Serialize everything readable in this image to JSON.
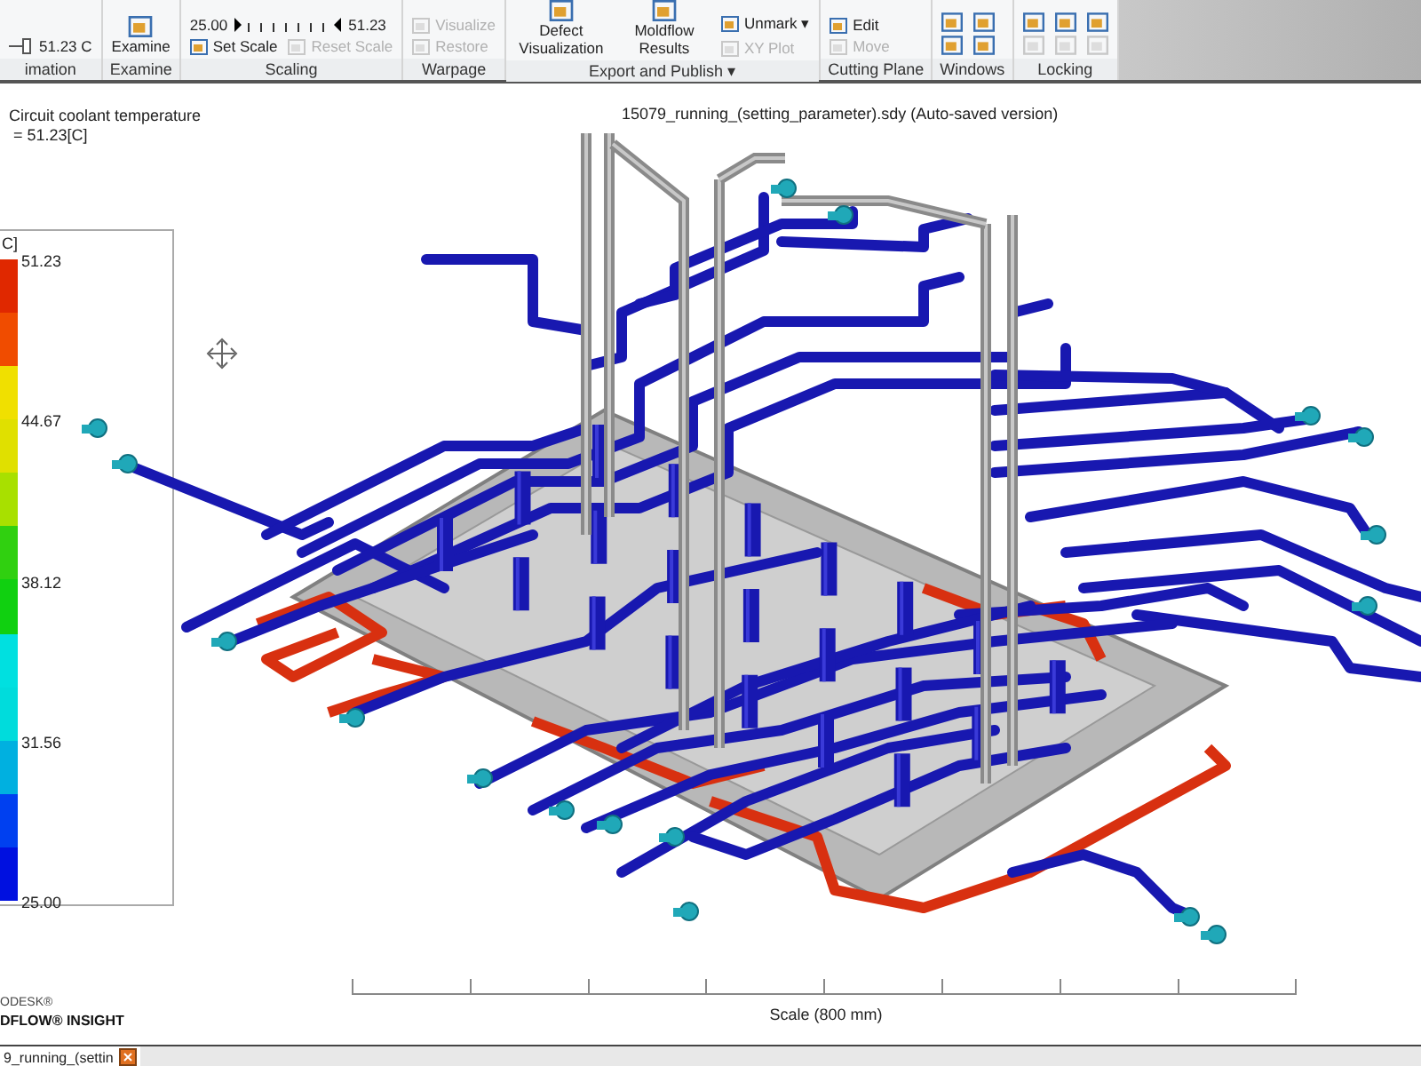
{
  "ribbon": {
    "groups": [
      {
        "label": "imation",
        "rows": [
          [
            {
              "kind": "value",
              "label": "51.23 C"
            }
          ]
        ]
      },
      {
        "label": "Examine",
        "rows": [
          [
            {
              "kind": "large",
              "label": "Examine",
              "disabled": false
            }
          ]
        ]
      },
      {
        "label": "Scaling",
        "rows": [
          [
            {
              "kind": "scale",
              "min": "25.00",
              "max": "51.23",
              "level": 1
            }
          ],
          [
            {
              "kind": "small",
              "label": "Set Scale",
              "disabled": false
            },
            {
              "kind": "small",
              "label": "Reset Scale",
              "disabled": true
            }
          ]
        ]
      },
      {
        "label": "Warpage",
        "rows": [
          [
            {
              "kind": "small",
              "label": "Visualize",
              "disabled": true
            }
          ],
          [
            {
              "kind": "small",
              "label": "Restore",
              "disabled": true
            }
          ]
        ]
      },
      {
        "label": "Export and Publish ▾",
        "rows": [
          [
            {
              "kind": "large",
              "label": "Defect Visualization",
              "disabled": false
            },
            {
              "kind": "large",
              "label": "Moldflow Results",
              "disabled": false
            },
            {
              "kind": "stack",
              "items": [
                {
                  "kind": "small",
                  "label": "Unmark ▾",
                  "disabled": false
                },
                {
                  "kind": "small",
                  "label": "XY Plot",
                  "disabled": true
                }
              ]
            }
          ]
        ]
      },
      {
        "label": "Cutting Plane",
        "rows": [
          [
            {
              "kind": "small",
              "label": "Edit",
              "disabled": false
            }
          ],
          [
            {
              "kind": "small",
              "label": "Move",
              "disabled": true
            }
          ]
        ]
      },
      {
        "label": "Windows",
        "rows": [
          [
            {
              "kind": "icon",
              "disabled": false
            },
            {
              "kind": "icon",
              "disabled": false
            }
          ],
          [
            {
              "kind": "icon",
              "disabled": false
            },
            {
              "kind": "icon",
              "disabled": false
            }
          ]
        ]
      },
      {
        "label": "Locking",
        "rows": [
          [
            {
              "kind": "icon",
              "disabled": false
            },
            {
              "kind": "icon",
              "disabled": false
            },
            {
              "kind": "icon",
              "disabled": false
            }
          ],
          [
            {
              "kind": "icon",
              "disabled": true
            },
            {
              "kind": "icon",
              "disabled": true
            },
            {
              "kind": "icon",
              "disabled": true
            }
          ]
        ]
      }
    ]
  },
  "result": {
    "name": "Circuit coolant temperature",
    "value": "= 51.23[C]"
  },
  "title": "15079_running_(setting_parameter).sdy (Auto-saved version)",
  "legend": {
    "unit": "C]",
    "ticks": [
      "51.23",
      "44.67",
      "38.12",
      "31.56",
      "25.00"
    ],
    "bands": [
      {
        "color": "#e02800"
      },
      {
        "color": "#f04c00"
      },
      {
        "color": "#f0e000"
      },
      {
        "color": "#e0e000"
      },
      {
        "color": "#a8e000"
      },
      {
        "color": "#30d010"
      },
      {
        "color": "#10d010"
      },
      {
        "color": "#00e0e0"
      },
      {
        "color": "#00dcdc"
      },
      {
        "color": "#00b0e0"
      },
      {
        "color": "#0040f0"
      },
      {
        "color": "#0010e0"
      }
    ]
  },
  "scale_bar": {
    "label": "Scale (800 mm)"
  },
  "logo": {
    "line1": "ODESK®",
    "line2": "DFLOW® INSIGHT"
  },
  "document_tabs": [
    {
      "label": "9_running_(settin"
    }
  ]
}
